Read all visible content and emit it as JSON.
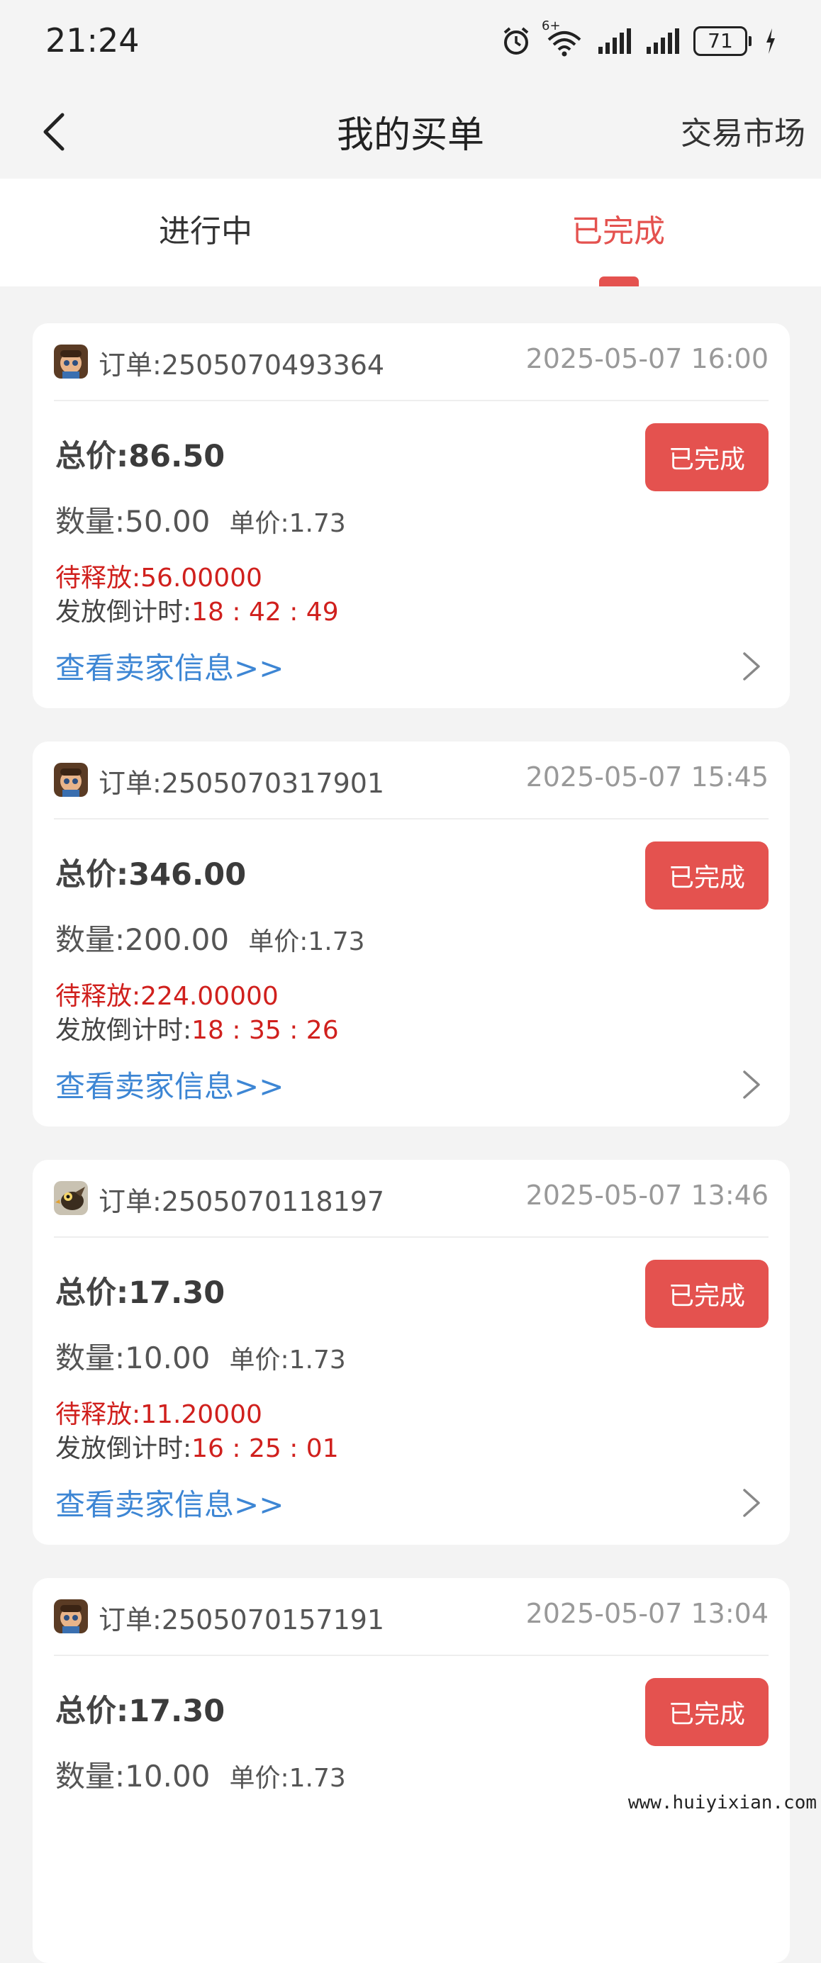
{
  "status_bar": {
    "time": "21:24",
    "battery": "71",
    "wifi_badge": "6+"
  },
  "nav": {
    "title": "我的买单",
    "right_link": "交易市场"
  },
  "tabs": [
    {
      "label": "进行中",
      "active": false
    },
    {
      "label": "已完成",
      "active": true
    }
  ],
  "colors": {
    "accent": "#e4524f",
    "link": "#3d86d4",
    "alert_text": "#d0201d"
  },
  "labels": {
    "order_prefix": "订单:",
    "total_label": "总价:",
    "qty_label": "数量:",
    "unit_label": "单价:",
    "pending_label": "待释放:",
    "countdown_label": "发放倒计时:",
    "seller_link": "查看卖家信息>>",
    "status": "已完成"
  },
  "orders": [
    {
      "id": "2505070493364",
      "time": "2025-05-07 16:00",
      "total": "86.50",
      "qty": "50.00",
      "unit_price": "1.73",
      "pending": "56.00000",
      "countdown": "18 : 42 : 49",
      "avatar_icon": "character-avatar-icon"
    },
    {
      "id": "2505070317901",
      "time": "2025-05-07 15:45",
      "total": "346.00",
      "qty": "200.00",
      "unit_price": "1.73",
      "pending": "224.00000",
      "countdown": "18 : 35 : 26",
      "avatar_icon": "character-avatar-icon"
    },
    {
      "id": "2505070118197",
      "time": "2025-05-07 13:46",
      "total": "17.30",
      "qty": "10.00",
      "unit_price": "1.73",
      "pending": "11.20000",
      "countdown": "16 : 25 : 01",
      "avatar_icon": "bird-avatar-icon"
    },
    {
      "id": "2505070157191",
      "time": "2025-05-07 13:04",
      "total": "17.30",
      "qty": "10.00",
      "unit_price": "1.73",
      "pending": "",
      "countdown": "",
      "avatar_icon": "character-avatar-icon"
    }
  ],
  "watermark": "www.huiyixian.com"
}
